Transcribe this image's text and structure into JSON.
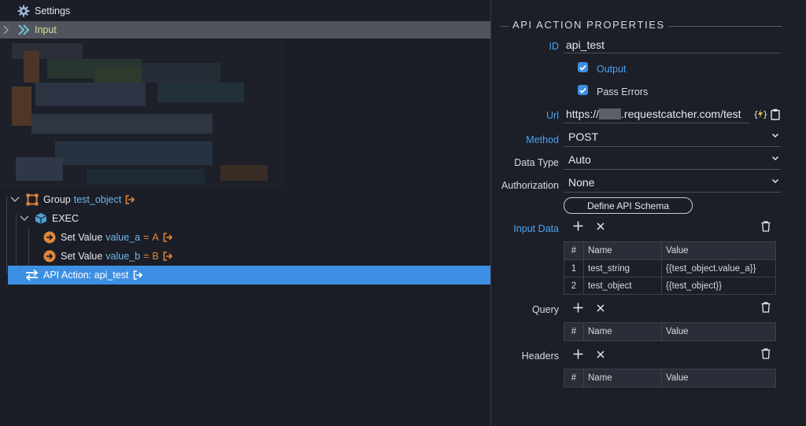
{
  "tree": {
    "settings_label": "Settings",
    "input_label": "Input",
    "group": {
      "prefix": "Group",
      "name": "test_object"
    },
    "exec_label": "EXEC",
    "set_value_a": {
      "prefix": "Set Value",
      "var": "value_a",
      "eq": "=",
      "val": "A"
    },
    "set_value_b": {
      "prefix": "Set Value",
      "var": "value_b",
      "eq": "=",
      "val": "B"
    },
    "api_action": {
      "label": "API Action: api_test"
    }
  },
  "panel": {
    "title": "API ACTION PROPERTIES",
    "id_label": "ID",
    "id_value": "api_test",
    "output_label": "Output",
    "output_checked": true,
    "pass_errors_label": "Pass Errors",
    "pass_errors_checked": true,
    "url_label": "Url",
    "url_prefix": "https://",
    "url_suffix": ".requestcatcher.com/test",
    "method_label": "Method",
    "method_value": "POST",
    "data_type_label": "Data Type",
    "data_type_value": "Auto",
    "authorization_label": "Authorization",
    "authorization_value": "None",
    "schema_button": "Define API Schema",
    "input_data_label": "Input Data",
    "query_label": "Query",
    "headers_label": "Headers",
    "table_headers": [
      "#",
      "Name",
      "Value"
    ],
    "input_rows": [
      {
        "n": "1",
        "name": "test_string",
        "value": "{{test_object.value_a}}"
      },
      {
        "n": "2",
        "name": "test_object",
        "value": "{{test_object}}"
      }
    ]
  },
  "colors": {
    "selected_row": "#3d8fe4",
    "input_row": "#51545d",
    "accent_label": "#4aa3f0",
    "orange": "#e3873a",
    "checkbox": "#3b8ee3"
  }
}
